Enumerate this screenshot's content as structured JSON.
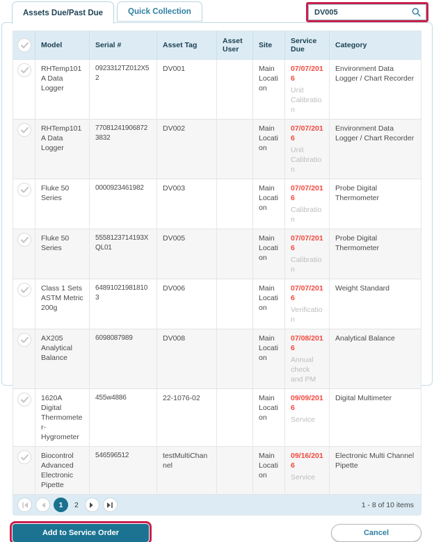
{
  "colors": {
    "primary_teal": "#1b7391",
    "tab_text_active": "#1d4355",
    "tab_text_inactive": "#2e7fa3",
    "header_bg": "#ddecf4",
    "due_date_red": "#f2493f",
    "service_type_gray": "#bdbdbd",
    "annotation_highlight": "#c9204c"
  },
  "tabs": [
    {
      "label": "Assets Due/Past Due",
      "active": true
    },
    {
      "label": "Quick Collection",
      "active": false
    }
  ],
  "search": {
    "value": "DV005"
  },
  "table": {
    "columns": [
      "Model",
      "Serial #",
      "Asset Tag",
      "Asset User",
      "Site",
      "Service Due",
      "Category"
    ],
    "rows": [
      {
        "model": "RHTemp101A Data Logger",
        "serial": "0923312TZ012X52",
        "asset_tag": "DV001",
        "asset_user": "",
        "site": "Main Location",
        "service_due_date": "07/07/2016",
        "service_due_type": "Unit Calibration",
        "category": "Environment Data Logger / Chart Recorder"
      },
      {
        "model": "RHTemp101A Data Logger",
        "serial": "770812419068723832",
        "asset_tag": "DV002",
        "asset_user": "",
        "site": "Main Location",
        "service_due_date": "07/07/2016",
        "service_due_type": "Unit Calibration",
        "category": "Environment Data Logger / Chart Recorder"
      },
      {
        "model": "Fluke 50 Series",
        "serial": "0000923461982",
        "asset_tag": "DV003",
        "asset_user": "",
        "site": "Main Location",
        "service_due_date": "07/07/2016",
        "service_due_type": "Calibration",
        "category": "Probe Digital Thermometer"
      },
      {
        "model": "Fluke 50 Series",
        "serial": "5558123714193XQL01",
        "asset_tag": "DV005",
        "asset_user": "",
        "site": "Main Location",
        "service_due_date": "07/07/2016",
        "service_due_type": "Calibration",
        "category": "Probe Digital Thermometer"
      },
      {
        "model": "Class 1 Sets ASTM Metric 200g",
        "serial": "648910219818103",
        "asset_tag": "DV006",
        "asset_user": "",
        "site": "Main Location",
        "service_due_date": "07/07/2016",
        "service_due_type": "Verification",
        "category": "Weight Standard"
      },
      {
        "model": "AX205 Analytical Balance",
        "serial": "6098087989",
        "asset_tag": "DV008",
        "asset_user": "",
        "site": "Main Location",
        "service_due_date": "07/08/2016",
        "service_due_type": "Annual check and PM",
        "category": "Analytical Balance"
      },
      {
        "model": "1620A Digital Thermometer-Hygrometer",
        "serial": "455w4886",
        "asset_tag": "22-1076-02",
        "asset_user": "",
        "site": "Main Location",
        "service_due_date": "09/09/2016",
        "service_due_type": "Service",
        "category": "Digital Multimeter"
      },
      {
        "model": "Biocontrol Advanced Electronic Pipette",
        "serial": "546596512",
        "asset_tag": "testMultiChannel",
        "asset_user": "",
        "site": "Main Location",
        "service_due_date": "09/16/2016",
        "service_due_type": "Service",
        "category": "Electronic Multi Channel Pipette"
      }
    ]
  },
  "pagination": {
    "pages": [
      "1",
      "2"
    ],
    "current_page": "1",
    "summary": "1 - 8 of 10 items"
  },
  "actions": {
    "add_to_service_order": "Add to Service Order",
    "cancel": "Cancel"
  }
}
